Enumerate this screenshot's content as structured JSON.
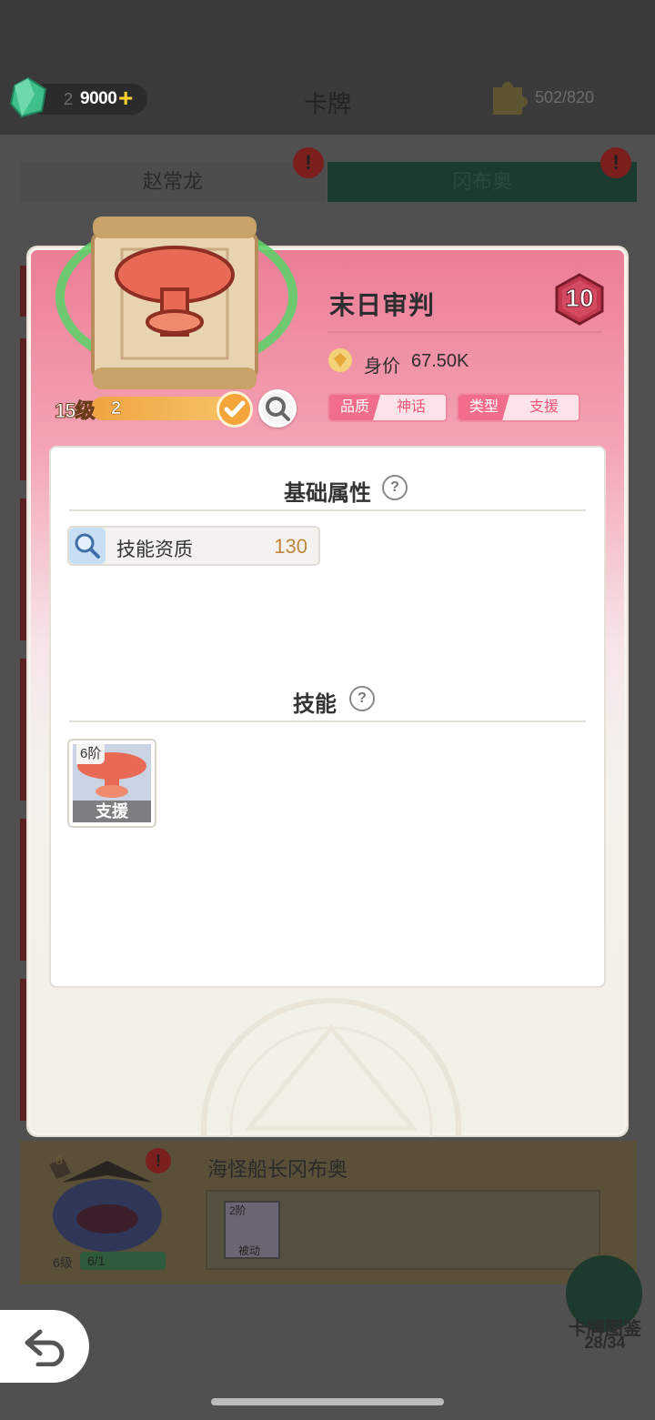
{
  "topbar": {
    "gem_value": "9000",
    "gem_ghost": "2",
    "gem_plus": "+",
    "title": "卡牌",
    "puzzle_value": "502/820"
  },
  "hero_tabs": [
    {
      "label": "赵常龙",
      "alert": "!"
    },
    {
      "label": "冈布奥",
      "alert": "!"
    }
  ],
  "card": {
    "name": "末日审判",
    "cost": "10",
    "level": "15级",
    "level_sub": "2",
    "price_label": "身价",
    "price_value": "67.50K",
    "quality_key": "品质",
    "quality_value": "神话",
    "type_key": "类型",
    "type_value": "支援"
  },
  "basic_attributes": {
    "title": "基础属性",
    "help": "?",
    "items": [
      {
        "label": "技能资质",
        "value": "130",
        "icon": "magnifier-icon"
      }
    ]
  },
  "skills": {
    "title": "技能",
    "help": "?",
    "items": [
      {
        "level": "6阶",
        "name": "支援",
        "icon": "mushroom-cloud-icon"
      }
    ]
  },
  "background_card": {
    "title": "海怪船长冈布奥",
    "cost": "8",
    "level": "6级",
    "progress": "6/1",
    "alert": "!",
    "skill_level": "2阶",
    "skill_name": "被动"
  },
  "gallery": {
    "label": "卡牌图鉴",
    "count": "28/34"
  },
  "colors": {
    "panel_top": "#ec7d96",
    "tag_accent": "#f26d8b",
    "attr_value": "#c1853c",
    "cost_badge": "#c2384f"
  }
}
